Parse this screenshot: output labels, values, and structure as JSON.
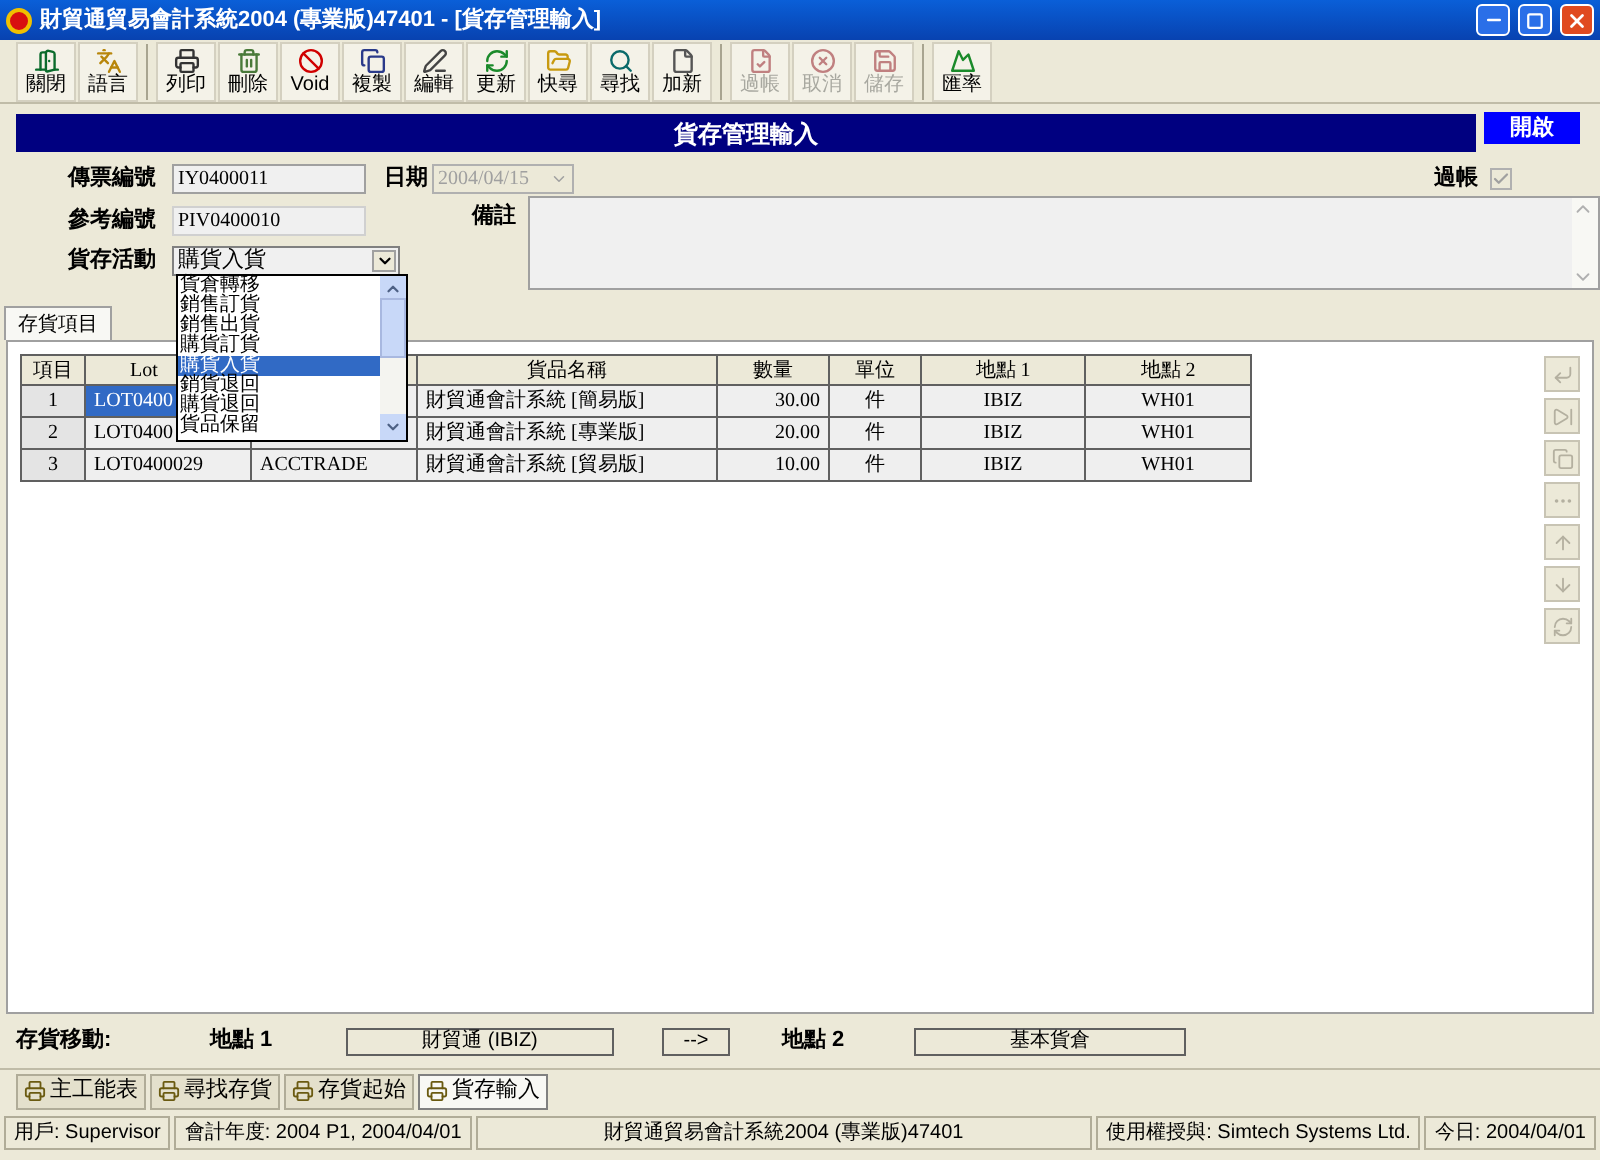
{
  "window": {
    "title": "財貿通貿易會計系統2004 (專業版)47401  - [貨存管理輸入]"
  },
  "toolbar": [
    [
      {
        "label": "關閉",
        "kind": "exit",
        "disabled": false
      },
      {
        "label": "語言",
        "kind": "language",
        "disabled": false
      }
    ],
    [
      {
        "label": "列印",
        "kind": "print",
        "disabled": false
      },
      {
        "label": "刪除",
        "kind": "delete",
        "disabled": false
      },
      {
        "label": "Void",
        "kind": "void",
        "disabled": false
      },
      {
        "label": "複製",
        "kind": "copy",
        "disabled": false
      },
      {
        "label": "編輯",
        "kind": "edit",
        "disabled": false
      },
      {
        "label": "更新",
        "kind": "refresh",
        "disabled": false
      },
      {
        "label": "快尋",
        "kind": "folder",
        "disabled": false
      },
      {
        "label": "尋找",
        "kind": "find",
        "disabled": false
      },
      {
        "label": "加新",
        "kind": "new",
        "disabled": false
      }
    ],
    [
      {
        "label": "過帳",
        "kind": "post",
        "disabled": true
      },
      {
        "label": "取消",
        "kind": "cancel",
        "disabled": true
      },
      {
        "label": "儲存",
        "kind": "save",
        "disabled": true
      }
    ],
    [
      {
        "label": "匯率",
        "kind": "rate",
        "disabled": false
      }
    ]
  ],
  "header": {
    "title": "貨存管理輸入",
    "status": "開啟"
  },
  "form": {
    "voucher_label": "傳票編號",
    "voucher": "IY0400011",
    "date_label": "日期",
    "date": "2004/04/15",
    "date_disabled": true,
    "posted_label": "過帳",
    "posted": true,
    "posted_disabled": true,
    "ref_label": "參考編號",
    "ref": "PIV0400010",
    "remark_label": "備註",
    "activity_label": "貨存活動",
    "activity": "購貨入貨",
    "activity_expanded": true,
    "activity_options": [
      {
        "label": "貨倉轉移",
        "selected": false
      },
      {
        "label": "銷售訂貨",
        "selected": false
      },
      {
        "label": "銷售出貨",
        "selected": false
      },
      {
        "label": "購貨訂貨",
        "selected": false
      },
      {
        "label": "購貨入貨",
        "selected": true
      },
      {
        "label": "銷貨退回",
        "selected": false
      },
      {
        "label": "購貨退回",
        "selected": false
      },
      {
        "label": "貨品保留",
        "selected": false
      }
    ]
  },
  "tabs": [
    {
      "label": "存貨項目",
      "selected": true
    }
  ],
  "table": {
    "columns": [
      "項目",
      "Lot",
      null,
      "貨品名稱",
      "數量",
      "單位",
      "地點 1",
      "地點 2"
    ],
    "rows": [
      {
        "cells": [
          "1",
          "LOT0400",
          null,
          "財貿通會計系統 [簡易版]",
          "30.00",
          "件",
          "IBIZ",
          "WH01"
        ],
        "selected": true
      },
      {
        "cells": [
          "2",
          "LOT0400",
          null,
          "財貿通會計系統 [專業版]",
          "20.00",
          "件",
          "IBIZ",
          "WH01"
        ],
        "selected": false
      },
      {
        "cells": [
          "3",
          "LOT0400029",
          "ACCTRADE",
          "財貿通會計系統 [貿易版]",
          "10.00",
          "件",
          "IBIZ",
          "WH01"
        ],
        "selected": false
      }
    ]
  },
  "side_tools": [
    {
      "kind": "corner",
      "disabled": true
    },
    {
      "kind": "last",
      "disabled": true
    },
    {
      "kind": "copy",
      "disabled": true
    },
    {
      "kind": "dots",
      "disabled": true
    },
    {
      "kind": "up",
      "disabled": true
    },
    {
      "kind": "down",
      "disabled": true
    },
    {
      "kind": "refresh",
      "disabled": true
    }
  ],
  "transfer": {
    "label": "存貨移動:",
    "from_label": "地點 1",
    "from": "財貿通 (IBIZ)",
    "arrow": "-->",
    "to_label": "地點 2",
    "to": "基本貨倉"
  },
  "bottom_tabs": [
    {
      "label": "主工能表",
      "selected": false
    },
    {
      "label": "尋找存貨",
      "selected": false
    },
    {
      "label": "存貨起始",
      "selected": false
    },
    {
      "label": "貨存輸入",
      "selected": true
    }
  ],
  "status_bar": [
    "用戶: Supervisor",
    "會計年度: 2004 P1, 2004/04/01",
    "財貿通貿易會計系統2004 (專業版)47401",
    "使用權授與: Simtech Systems Ltd.",
    "今日: 2004/04/01"
  ]
}
